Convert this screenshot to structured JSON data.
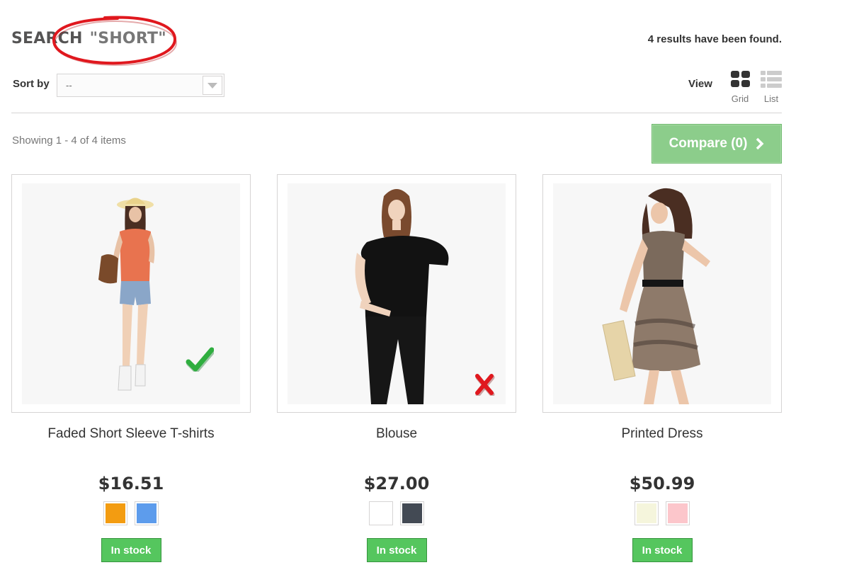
{
  "search": {
    "heading": "SEARCH",
    "query": "\"SHORT\"",
    "results_text": "4 results have been found."
  },
  "sort": {
    "label": "Sort by",
    "selected": "--"
  },
  "view": {
    "label": "View",
    "grid_label": "Grid",
    "list_label": "List",
    "active": "grid"
  },
  "listing": {
    "showing_text": "Showing 1 - 4 of 4 items",
    "compare_label": "Compare (0)"
  },
  "products": [
    {
      "name": "Faded Short Sleeve T-shirts",
      "price": "$16.51",
      "colors": [
        "#f39c11",
        "#5d9cec"
      ],
      "stock": "In stock",
      "annotation": "green-checkmark"
    },
    {
      "name": "Blouse",
      "price": "$27.00",
      "colors": [
        "#ffffff",
        "#434a54"
      ],
      "stock": "In stock",
      "annotation": "red-cross"
    },
    {
      "name": "Printed Dress",
      "price": "$50.99",
      "colors": [
        "#f5f5dc",
        "#fcc6cb"
      ],
      "stock": "In stock",
      "annotation": ""
    }
  ],
  "colors": {
    "compare_button": "#8ccd8b",
    "in_stock": "#55c65e",
    "annotation_ring": "#e0181e"
  }
}
